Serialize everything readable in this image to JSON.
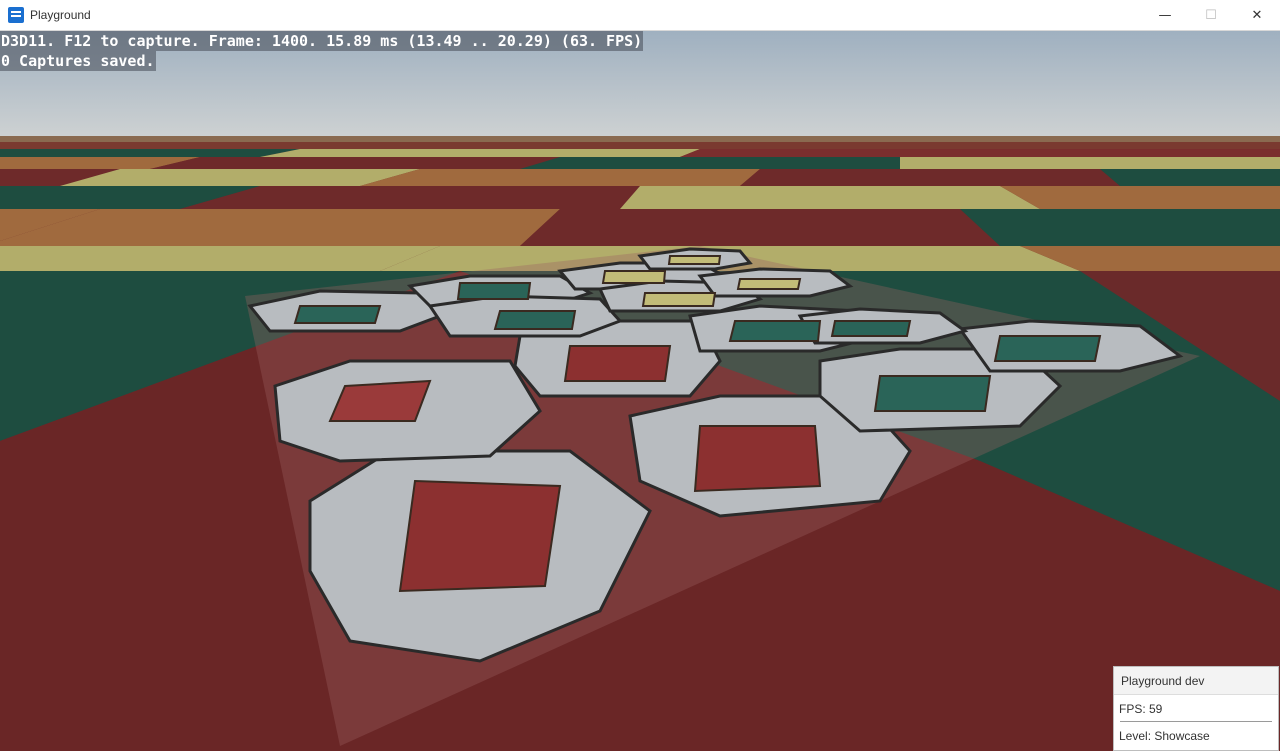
{
  "window": {
    "title": "Playground",
    "minimize_glyph": "—",
    "maximize_glyph": "☐",
    "close_glyph": "✕"
  },
  "overlay": {
    "line1": "D3D11. F12 to capture. Frame: 1400. 15.89 ms (13.49 .. 20.29) (63. FPS)",
    "line2": "0 Captures saved."
  },
  "panel": {
    "title": "Playground dev",
    "fps": "FPS: 59",
    "level": "Level: Showcase"
  },
  "colors": {
    "sky_top": "#a8b4c0",
    "sky_horizon": "#c9cdcf",
    "tile_red": "#6e2a2a",
    "tile_green": "#1e4d40",
    "tile_yellow": "#b2ad6a",
    "tile_orange": "#a06a3e",
    "ring_gray": "#b8bcc0"
  }
}
